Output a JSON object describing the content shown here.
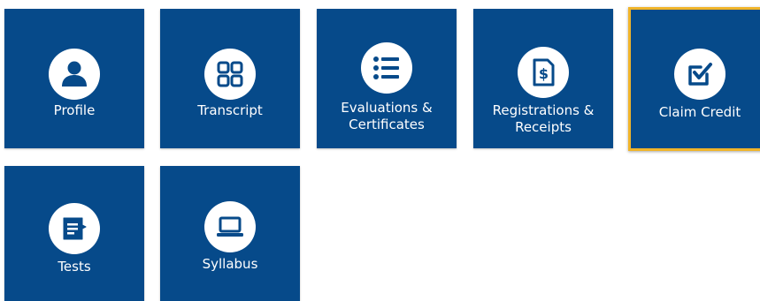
{
  "colors": {
    "tile": "#064a8a",
    "icon": "#064a8a",
    "selected_border": "#f0b429"
  },
  "tiles": [
    {
      "label": "Profile",
      "icon": "person-icon",
      "selected": false
    },
    {
      "label": "Transcript",
      "icon": "grid-icon",
      "selected": false
    },
    {
      "label_line1": "Evaluations &",
      "label_line2": "Certificates",
      "icon": "list-icon",
      "selected": false
    },
    {
      "label_line1": "Registrations &",
      "label_line2": "Receipts",
      "icon": "receipt-icon",
      "selected": false
    },
    {
      "label": "Claim Credit",
      "icon": "checkbox-icon",
      "selected": true
    },
    {
      "label": "Tests",
      "icon": "document-icon",
      "selected": false
    },
    {
      "label": "Syllabus",
      "icon": "laptop-icon",
      "selected": false
    }
  ]
}
